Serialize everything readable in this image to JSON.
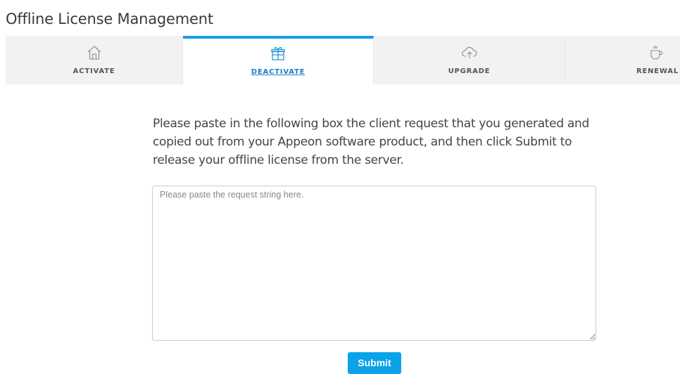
{
  "page": {
    "title": "Offline License Management"
  },
  "tabs": [
    {
      "label": "ACTIVATE",
      "icon": "home-icon",
      "active": false
    },
    {
      "label": "DEACTIVATE",
      "icon": "gift-icon",
      "active": true
    },
    {
      "label": "UPGRADE",
      "icon": "cloud-upload-icon",
      "active": false
    },
    {
      "label": "RENEWAL",
      "icon": "cup-icon",
      "active": false
    }
  ],
  "main": {
    "instructions": "Please paste in the following box the client request that you generated and copied out from your Appeon software product, and then click Submit to release your offline license from the server.",
    "request_placeholder": "Please paste the request string here.",
    "submit_label": "Submit"
  },
  "colors": {
    "accent": "#1a9ee6",
    "active_tab_text": "#1b7fc4",
    "button": "#0aa3e8",
    "tab_bar": "#f2f2f2"
  }
}
